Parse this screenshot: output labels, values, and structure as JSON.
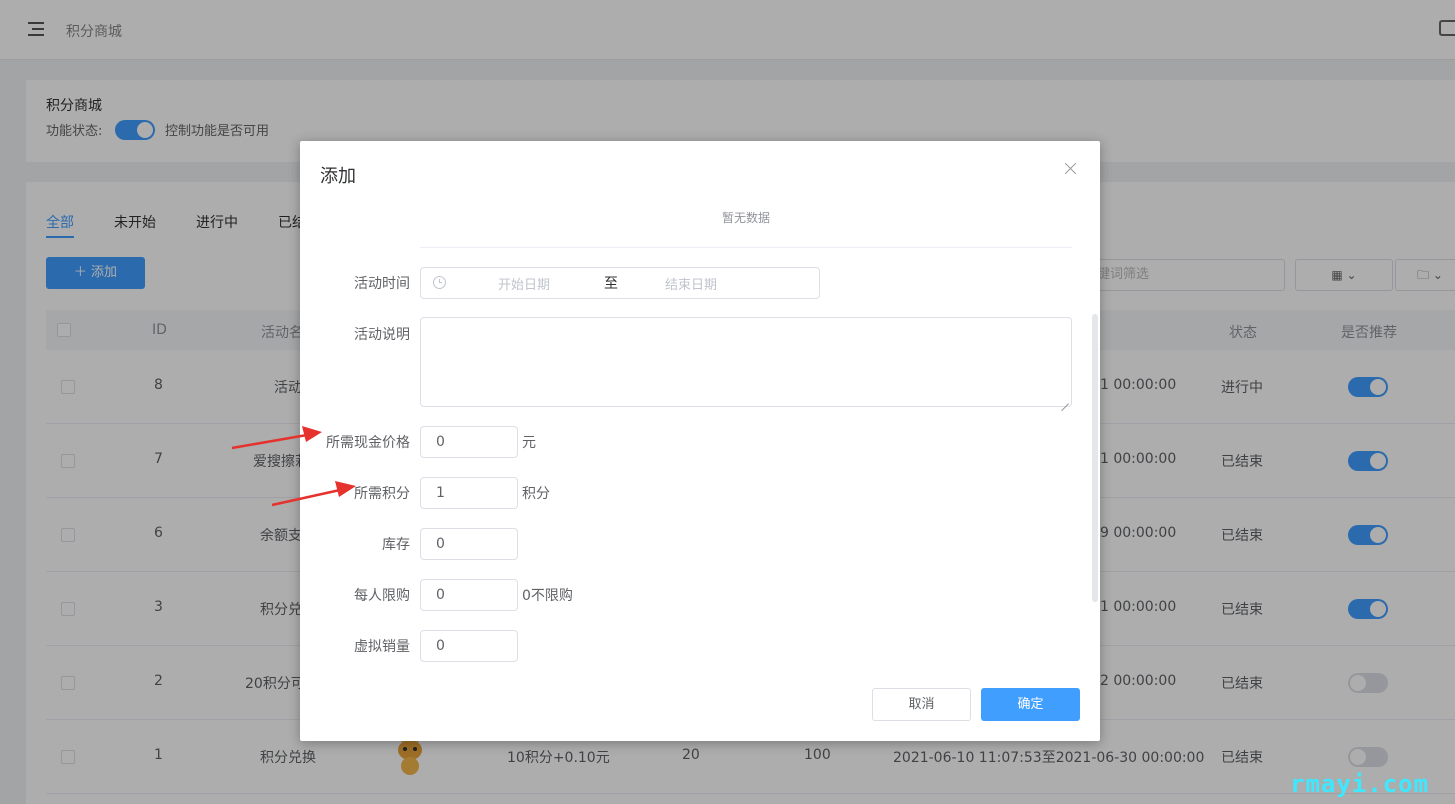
{
  "header": {
    "breadcrumb": "积分商城"
  },
  "feature_card": {
    "title": "积分商城",
    "status_label": "功能状态:",
    "switch_on": true,
    "hint": "控制功能是否可用"
  },
  "tabs": [
    {
      "label": "全部",
      "active": true
    },
    {
      "label": "未开始"
    },
    {
      "label": "进行中"
    },
    {
      "label": "已结"
    }
  ],
  "toolbar": {
    "add_label": "＋ 添加",
    "filter_placeholder": "键词筛选"
  },
  "table": {
    "headers": {
      "id": "ID",
      "name": "活动名",
      "status": "状态",
      "recommend": "是否推荐"
    },
    "rows": [
      {
        "id": "8",
        "name": "活动",
        "time": "1 00:00:00",
        "status": "进行中",
        "recommend": true
      },
      {
        "id": "7",
        "name": "爱搜擦莉",
        "time": "1 00:00:00",
        "status": "已结束",
        "recommend": true
      },
      {
        "id": "6",
        "name": "余额支",
        "time": "9 00:00:00",
        "status": "已结束",
        "recommend": true
      },
      {
        "id": "3",
        "name": "积分兑",
        "time": "1 00:00:00",
        "status": "已结束",
        "recommend": true
      },
      {
        "id": "2",
        "name": "20积分可",
        "time": "2 00:00:00",
        "status": "已结束",
        "recommend": false
      },
      {
        "id": "1",
        "name": "积分兑换",
        "price": "10积分+0.10元",
        "stock": "20",
        "sales": "100",
        "time": "2021-06-10 11:07:53至2021-06-30 00:00:00",
        "status": "已结束",
        "recommend": false
      }
    ]
  },
  "modal": {
    "title": "添加",
    "empty_text": "暂无数据",
    "fields": {
      "time_label": "活动时间",
      "start_placeholder": "开始日期",
      "range_sep": "至",
      "end_placeholder": "结束日期",
      "desc_label": "活动说明",
      "price_label": "所需现金价格",
      "price_value": "0",
      "price_unit": "元",
      "points_label": "所需积分",
      "points_value": "1",
      "points_unit": "积分",
      "stock_label": "库存",
      "stock_value": "0",
      "limit_label": "每人限购",
      "limit_value": "0",
      "limit_hint": "0不限购",
      "virtual_label": "虚拟销量",
      "virtual_value": "0"
    },
    "cancel_label": "取消",
    "confirm_label": "确定"
  },
  "watermark": "rmayi.com",
  "colors": {
    "primary": "#409eff",
    "annotation_arrow": "#e5322d",
    "watermark": "#3ee8ff"
  }
}
